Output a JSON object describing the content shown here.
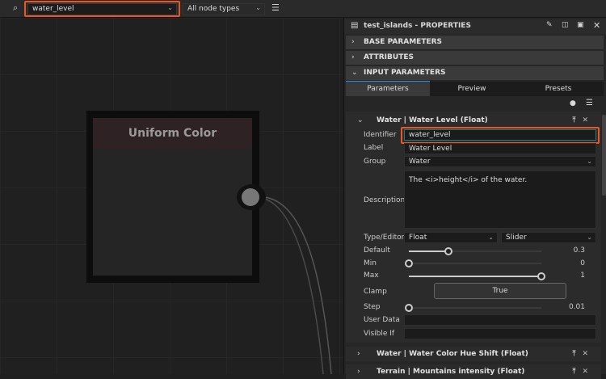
{
  "toolbar": {
    "search_value": "water_level",
    "node_type": "All node types"
  },
  "node": {
    "title": "Uniform Color"
  },
  "panel": {
    "title": "test_islands - PROPERTIES",
    "sections": [
      "BASE PARAMETERS",
      "ATTRIBUTES",
      "INPUT PARAMETERS"
    ],
    "tabs": [
      "Parameters",
      "Preview",
      "Presets"
    ],
    "param": {
      "header": "Water | Water Level (Float)",
      "labels": {
        "identifier": "Identifier",
        "label": "Label",
        "group": "Group",
        "description": "Description",
        "type": "Type/Editor",
        "default": "Default",
        "min": "Min",
        "max": "Max",
        "clamp": "Clamp",
        "step": "Step",
        "user_data": "User Data",
        "visible_if": "Visible If"
      },
      "identifier": "water_level",
      "label": "Water Level",
      "group": "Water",
      "description": "The <i>height</i> of the water.",
      "type": "Float",
      "editor": "Slider",
      "default": "0.3",
      "default_fraction": 0.3,
      "min": "0",
      "max": "1",
      "clamp": "True",
      "step": "0.01",
      "user_data": "",
      "visible_if": ""
    },
    "collapsed": [
      "Water | Water Color Hue Shift (Float)",
      "Terrain | Mountains intensity (Float)"
    ]
  },
  "colors": {
    "highlight": "#e8572a",
    "accent": "#2f8fd8"
  }
}
